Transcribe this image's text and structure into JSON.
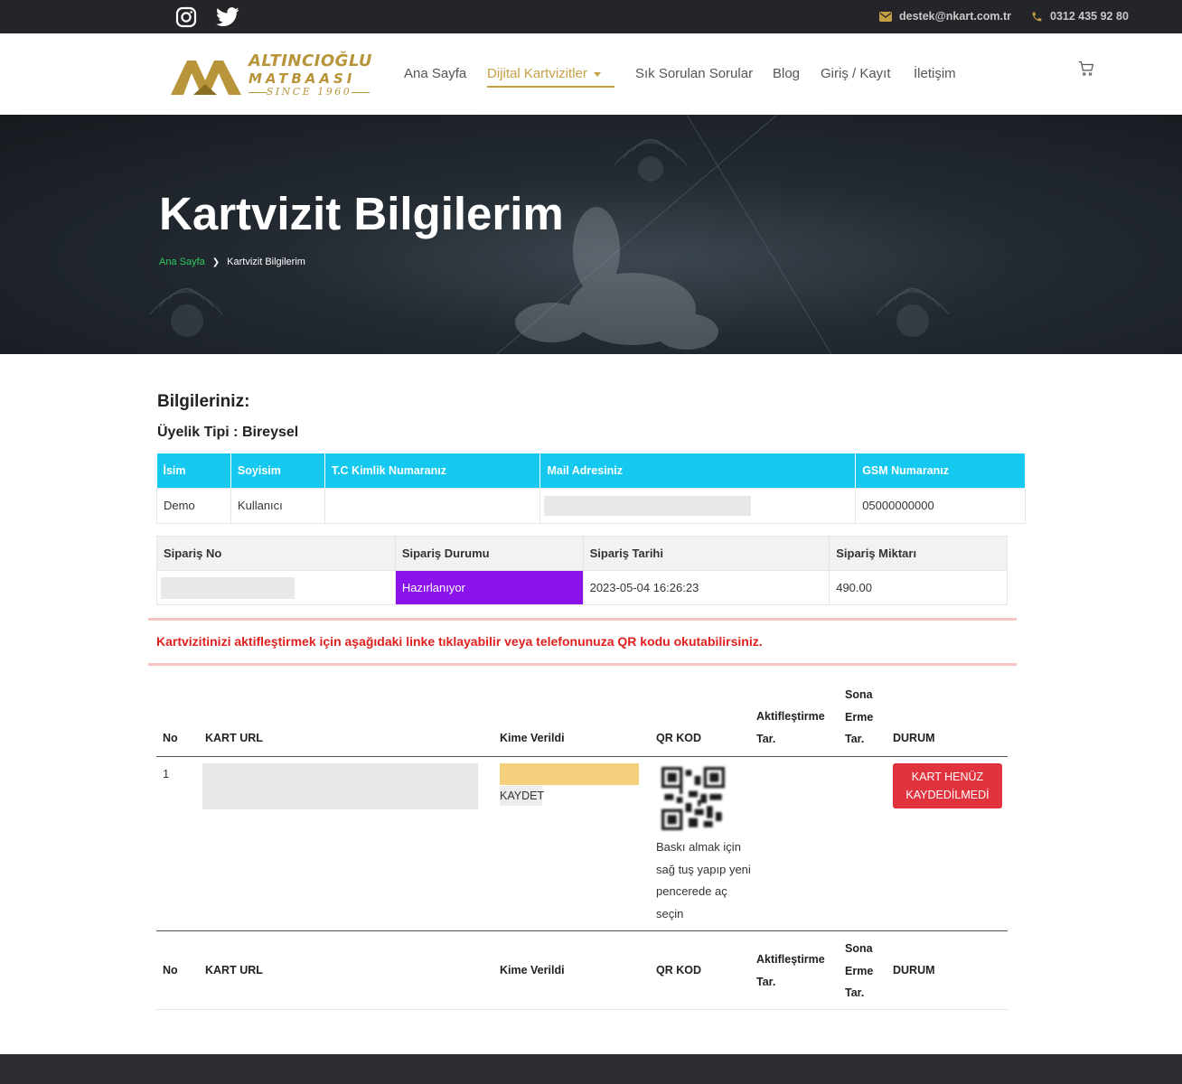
{
  "topbar": {
    "email": "destek@nkart.com.tr",
    "phone": "0312 435 92 80",
    "social": [
      "instagram-icon",
      "twitter-icon"
    ]
  },
  "logo": {
    "line1": "ALTINCIOĞLU",
    "line2": "MATBAASI",
    "line3": "SINCE 1960"
  },
  "nav": {
    "home": "Ana Sayfa",
    "digital": "Dijital Kartvizitler",
    "faq": "Sık Sorulan Sorular",
    "blog": "Blog",
    "login": "Giriş / Kayıt",
    "contact": "İletişim"
  },
  "hero": {
    "title": "Kartvizit Bilgilerim",
    "breadcrumb_home": "Ana Sayfa",
    "breadcrumb_current": "Kartvizit Bilgilerim"
  },
  "info": {
    "heading": "Bilgileriniz:",
    "membership": "Üyelik Tipi : Bireysel"
  },
  "user_table": {
    "headers": [
      "İsim",
      "Soyisim",
      "T.C Kimlik Numaranız",
      "Mail Adresiniz",
      "GSM Numaranız"
    ],
    "row": [
      "Demo",
      "Kullanıcı",
      "",
      "",
      "05000000000"
    ]
  },
  "order_table": {
    "headers": [
      "Sipariş No",
      "Sipariş Durumu",
      "Sipariş Tarihi",
      "Sipariş Miktarı"
    ],
    "row": [
      "",
      "Hazırlanıyor",
      "2023-05-04 16:26:23",
      "490.00"
    ]
  },
  "notice": "Kartvizitinizi aktifleştirmek için aşağıdaki linke tıklayabilir veya telefonunuza QR kodu okutabilirsiniz.",
  "card_table": {
    "headers": {
      "no": "No",
      "url": "KART URL",
      "given": "Kime Verildi",
      "qr": "QR KOD",
      "activation": "Aktifleştirme Tar.",
      "expiry": "Sona Erme Tar.",
      "status": "DURUM"
    },
    "row": {
      "no": "1",
      "save_label": "KAYDET",
      "qr_note": "Baskı almak için sağ tuş yapıp yeni pencerede aç seçin",
      "status_button": "KART HENÜZ KAYDEDİLMEDİ"
    }
  },
  "colors": {
    "accent_gold": "#c6a045",
    "table_header_cyan": "#14c8f0",
    "status_purple": "#8b12ea",
    "notice_red": "#e01f1f",
    "button_red": "#e0333e"
  }
}
